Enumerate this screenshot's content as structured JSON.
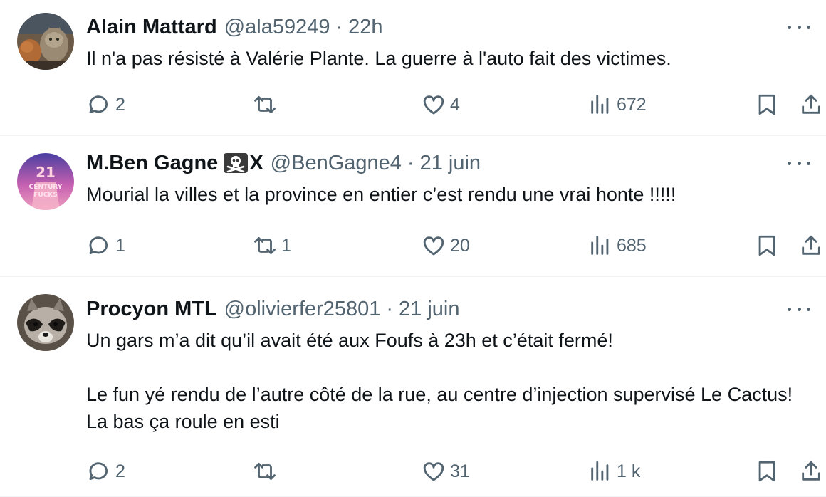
{
  "tweets": [
    {
      "name": "Alain Mattard",
      "handle": "@ala59249",
      "separator": "·",
      "time": "22h",
      "text": "Il n'a pas résisté à Valérie Plante. La guerre à l'auto fait des victimes.",
      "replies": "2",
      "retweets": "",
      "likes": "4",
      "views": "672",
      "avatar": "cats-photo"
    },
    {
      "name": "M.Ben Gagne",
      "name_suffix": "X",
      "name_emoji": "skull-and-crossbones-icon",
      "handle": "@BenGagne4",
      "separator": "·",
      "time": "21 juin",
      "text": "Mourial la villes et la province en entier  c’est rendu une vrai honte !!!!!",
      "replies": "1",
      "retweets": "1",
      "likes": "20",
      "views": "685",
      "avatar": "21st-century-logo"
    },
    {
      "name": "Procyon MTL",
      "handle": "@olivierfer25801",
      "separator": "·",
      "time": "21 juin",
      "text": "Un gars m’a dit qu’il avait été aux Foufs à 23h et c’était fermé!\n\nLe fun yé rendu de l’autre côté de la rue, au centre d’injection supervisé Le Cactus! La bas ça roule en esti",
      "replies": "2",
      "retweets": "",
      "likes": "31",
      "views": "1 k",
      "avatar": "raccoon-photo"
    }
  ],
  "colors": {
    "text": "#0f1419",
    "muted": "#536471",
    "divider": "#eff3f4"
  }
}
